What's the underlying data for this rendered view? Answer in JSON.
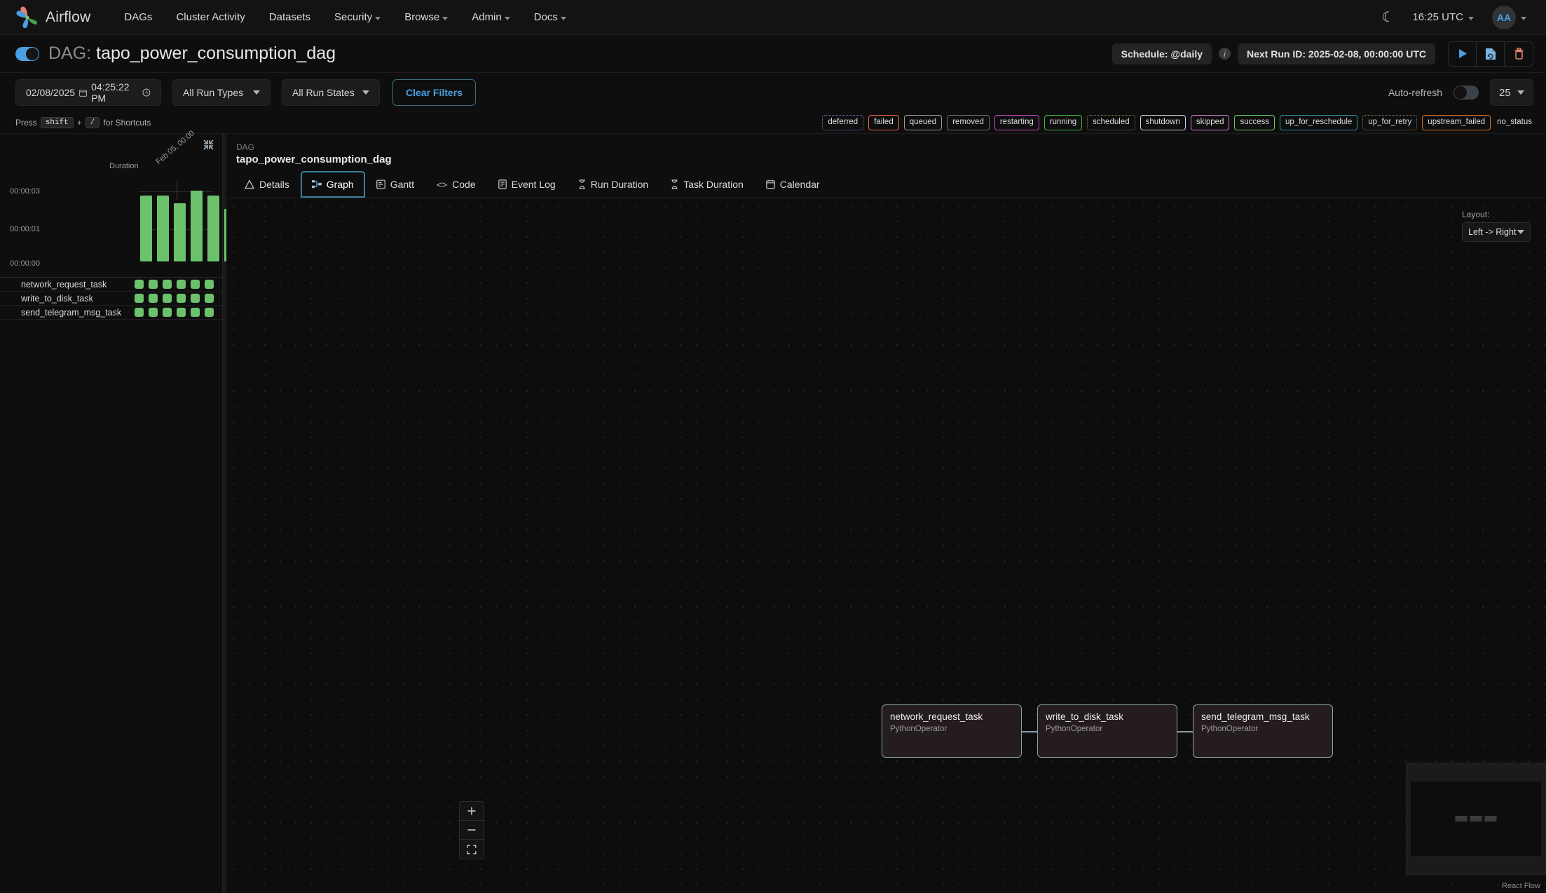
{
  "topnav": {
    "brand": "Airflow",
    "items": [
      {
        "label": "DAGs",
        "caret": false
      },
      {
        "label": "Cluster Activity",
        "caret": false
      },
      {
        "label": "Datasets",
        "caret": false
      },
      {
        "label": "Security",
        "caret": true
      },
      {
        "label": "Browse",
        "caret": true
      },
      {
        "label": "Admin",
        "caret": true
      },
      {
        "label": "Docs",
        "caret": true
      }
    ],
    "theme_icon": "moon-icon",
    "clock": "16:25 UTC",
    "avatar_initials": "AA"
  },
  "dag_header": {
    "prefix": "DAG:",
    "name": "tapo_power_consumption_dag",
    "paused_toggle_on": true,
    "schedule": "Schedule: @daily",
    "next_run": "Next Run ID: 2025-02-08, 00:00:00 UTC",
    "actions": [
      {
        "name": "trigger-dag-button",
        "icon": "play-icon"
      },
      {
        "name": "clear-dag-button",
        "icon": "refresh-icon"
      },
      {
        "name": "delete-dag-button",
        "icon": "trash-icon"
      }
    ]
  },
  "filters": {
    "date_value": "02/08/2025",
    "time_value": "04:25:22 PM",
    "run_types": "All Run Types",
    "run_states": "All Run States",
    "clear_label": "Clear Filters",
    "autorefresh_label": "Auto-refresh",
    "autorefresh_on": false,
    "num_runs": "25"
  },
  "shortcuts": {
    "press": "Press",
    "key1": "shift",
    "plus": "+",
    "key2": "/",
    "suffix": "for Shortcuts"
  },
  "legend": [
    {
      "label": "deferred",
      "color": "#9a63c7"
    },
    {
      "label": "failed",
      "color": "#e8684a"
    },
    {
      "label": "queued",
      "color": "#9c9c9c"
    },
    {
      "label": "removed",
      "color": "#6d6d6d"
    },
    {
      "label": "restarting",
      "color": "#c548c5"
    },
    {
      "label": "running",
      "color": "#3fbd3f"
    },
    {
      "label": "scheduled",
      "color": "#8a7450"
    },
    {
      "label": "shutdown",
      "color": "#c7d4e8"
    },
    {
      "label": "skipped",
      "color": "#d07ad0"
    },
    {
      "label": "success",
      "color": "#5fd35f"
    },
    {
      "label": "up_for_reschedule",
      "color": "#2f8fa3"
    },
    {
      "label": "up_for_retry",
      "color": "#8a7450"
    },
    {
      "label": "upstream_failed",
      "color": "#d4742a"
    },
    {
      "label": "no_status",
      "color": "transparent"
    }
  ],
  "grid": {
    "collapse_icon": "collapse-icon",
    "duration_label": "Duration",
    "y_ticks": [
      "00:00:03",
      "00:00:01",
      "00:00:00"
    ],
    "date_tick": "Feb 05, 00:00",
    "bar_color": "#6cc26c",
    "bars": [
      2.55,
      2.55,
      2.25,
      2.75,
      2.55,
      2.05
    ],
    "bar_max": 3,
    "tasks": [
      {
        "name": "network_request_task",
        "states": [
          "success",
          "success",
          "success",
          "success",
          "success",
          "success"
        ]
      },
      {
        "name": "write_to_disk_task",
        "states": [
          "success",
          "success",
          "success",
          "success",
          "success",
          "success"
        ]
      },
      {
        "name": "send_telegram_msg_task",
        "states": [
          "success",
          "success",
          "success",
          "success",
          "success",
          "success"
        ]
      }
    ]
  },
  "breadcrumb": {
    "kind": "DAG",
    "name": "tapo_power_consumption_dag"
  },
  "tabs": [
    {
      "label": "Details",
      "icon": "triangle-icon",
      "active": false
    },
    {
      "label": "Graph",
      "icon": "graph-icon",
      "active": true
    },
    {
      "label": "Gantt",
      "icon": "gantt-icon",
      "active": false
    },
    {
      "label": "Code",
      "icon": "code-icon",
      "active": false
    },
    {
      "label": "Event Log",
      "icon": "log-icon",
      "active": false
    },
    {
      "label": "Run Duration",
      "icon": "hourglass-icon",
      "active": false
    },
    {
      "label": "Task Duration",
      "icon": "hourglass-icon",
      "active": false
    },
    {
      "label": "Calendar",
      "icon": "calendar-icon",
      "active": false
    }
  ],
  "graph": {
    "layout_label": "Layout:",
    "layout_value": "Left -> Right",
    "nodes": [
      {
        "title": "network_request_task",
        "operator": "PythonOperator"
      },
      {
        "title": "write_to_disk_task",
        "operator": "PythonOperator"
      },
      {
        "title": "send_telegram_msg_task",
        "operator": "PythonOperator"
      }
    ],
    "zoom_controls": [
      {
        "name": "zoom-in-button",
        "glyph": "+"
      },
      {
        "name": "zoom-out-button",
        "glyph": "–"
      },
      {
        "name": "fit-view-button",
        "glyph": "⛶"
      }
    ],
    "attribution": "React Flow"
  }
}
